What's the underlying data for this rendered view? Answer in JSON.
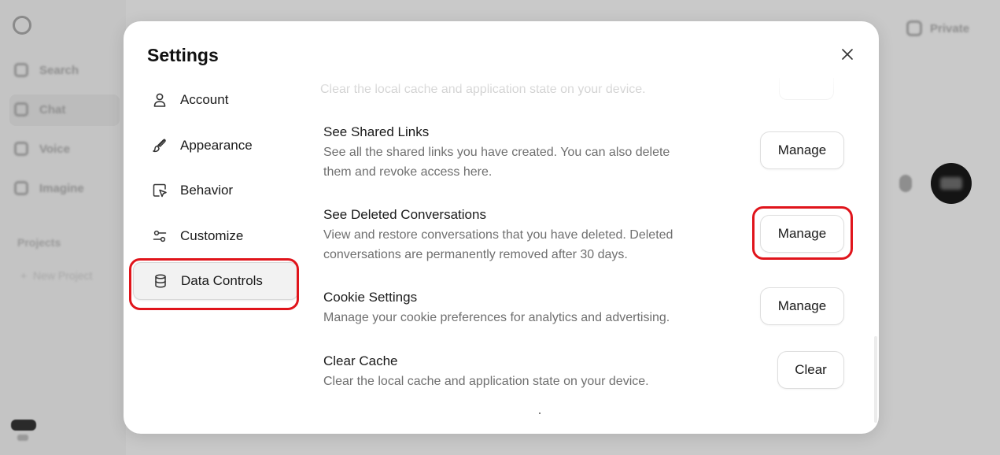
{
  "background": {
    "nav_items": [
      "Search",
      "Chat",
      "Voice",
      "Imagine"
    ],
    "projects_label": "Projects",
    "new_project_label": "New Project",
    "private_label": "Private"
  },
  "modal": {
    "title": "Settings",
    "close_icon": "close-icon"
  },
  "sidebar": {
    "items": [
      {
        "label": "Account",
        "icon": "user-icon"
      },
      {
        "label": "Appearance",
        "icon": "brush-icon"
      },
      {
        "label": "Behavior",
        "icon": "cursor-icon"
      },
      {
        "label": "Customize",
        "icon": "sliders-icon"
      },
      {
        "label": "Data Controls",
        "icon": "database-icon",
        "active": true
      }
    ]
  },
  "content": {
    "faded_desc": "Clear the local cache and application state on your device.",
    "rows": [
      {
        "title": "See Shared Links",
        "desc": "See all the shared links you have created. You can also delete them and revoke access here.",
        "button": "Manage"
      },
      {
        "title": "See Deleted Conversations",
        "desc": "View and restore conversations that you have deleted. Deleted conversations are permanently removed after 30 days.",
        "button": "Manage"
      },
      {
        "title": "Cookie Settings",
        "desc": "Manage your cookie preferences for analytics and advertising.",
        "button": "Manage"
      },
      {
        "title": "Clear Cache",
        "desc": "Clear the local cache and application state on your device.",
        "button": "Clear"
      }
    ]
  },
  "annotations": {
    "highlight_color": "#e0141b"
  }
}
